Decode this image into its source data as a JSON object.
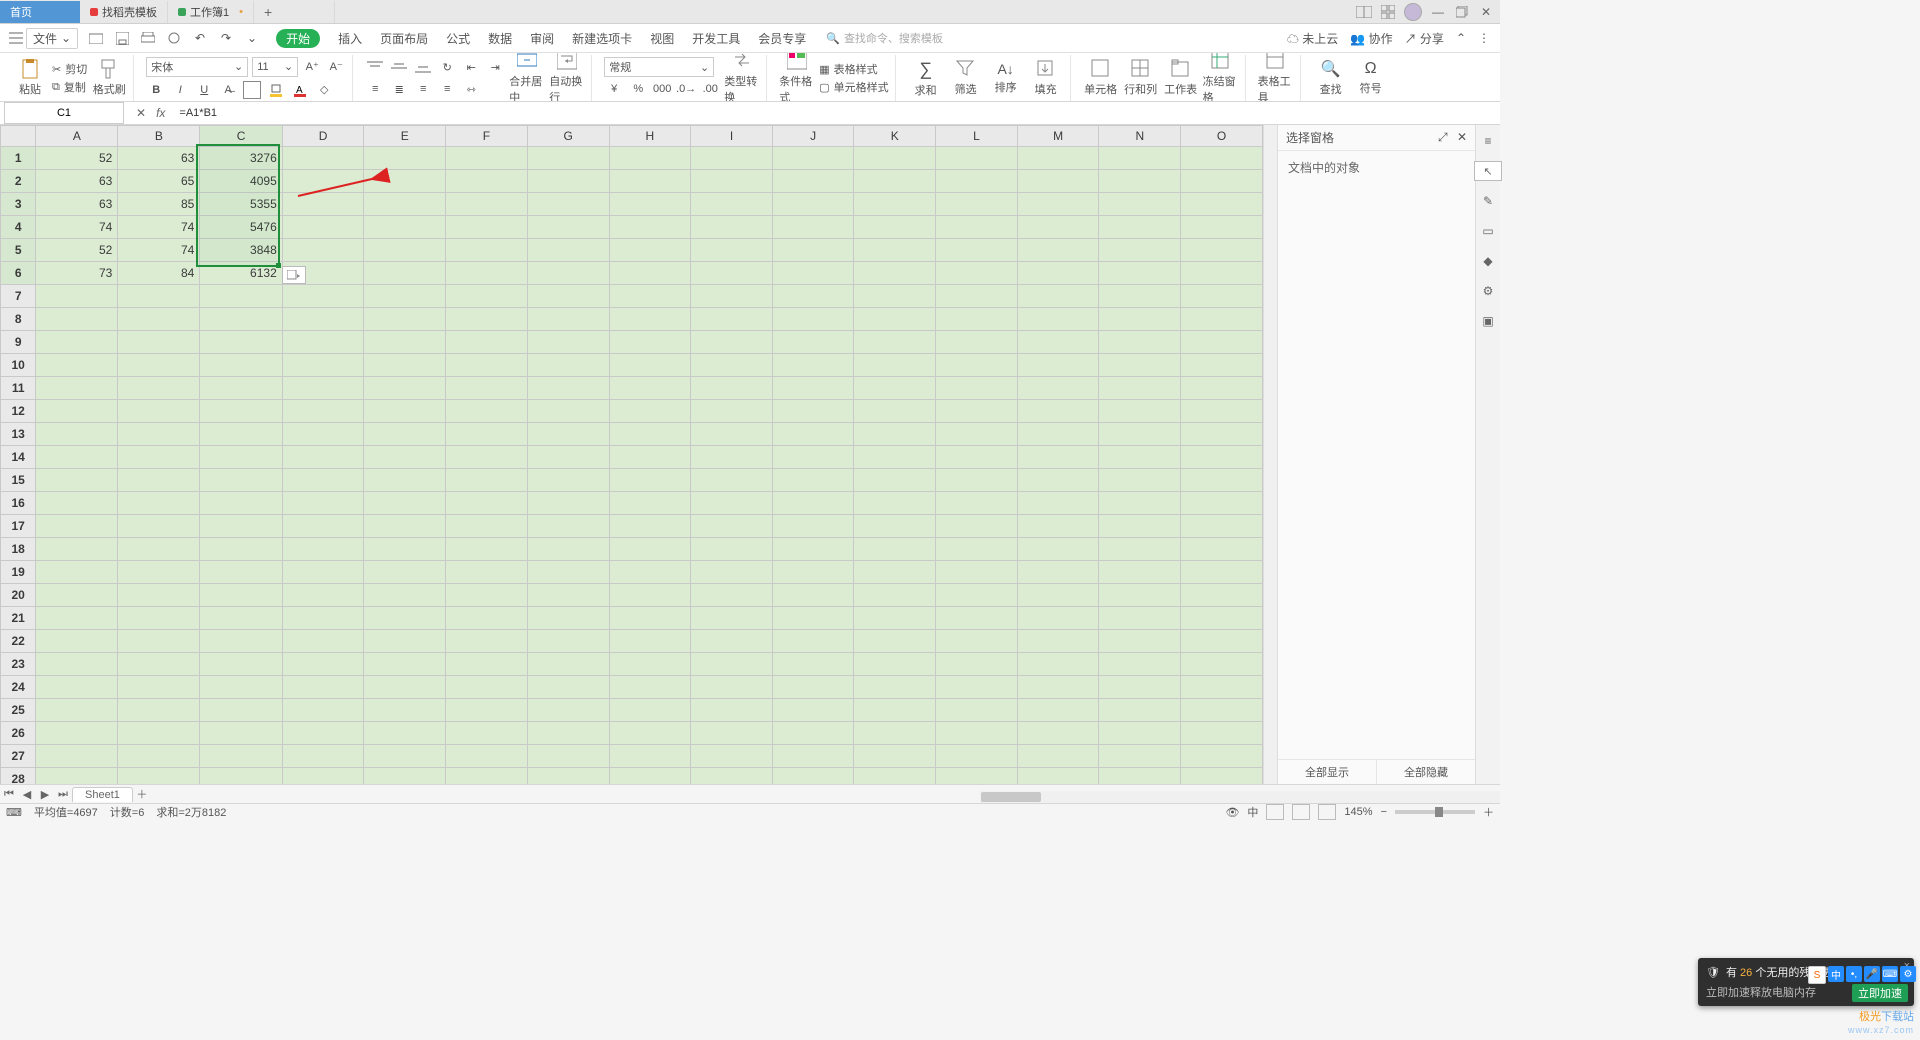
{
  "tabs": {
    "primary": "首页",
    "t1": "找稻壳模板",
    "t2": "工作簿1",
    "new": "+"
  },
  "file_menu": "文件",
  "menus": [
    "开始",
    "插入",
    "页面布局",
    "公式",
    "数据",
    "审阅",
    "新建选项卡",
    "视图",
    "开发工具",
    "会员专享"
  ],
  "search_placeholder": "查找命令、搜索模板",
  "cloud": "未上云",
  "coop": "协作",
  "share": "分享",
  "ribbon": {
    "paste": "粘贴",
    "cut": "剪切",
    "copy": "复制",
    "format_painter": "格式刷",
    "font_name": "宋体",
    "font_size": "11",
    "merge_center": "合并居中",
    "wrap": "自动换行",
    "number_fmt": "常规",
    "type_conv": "类型转换",
    "cond_fmt": "条件格式",
    "table_style": "表格样式",
    "cell_style": "单元格样式",
    "sum": "求和",
    "filter": "筛选",
    "sort": "排序",
    "fill": "填充",
    "cell": "单元格",
    "rowcol": "行和列",
    "sheet": "工作表",
    "freeze": "冻结窗格",
    "table_tool": "表格工具",
    "find": "查找",
    "symbol": "符号"
  },
  "namebox": "C1",
  "formula": "=A1*B1",
  "columns": [
    "A",
    "B",
    "C",
    "D",
    "E",
    "F",
    "G",
    "H",
    "I",
    "J",
    "K",
    "L",
    "M",
    "N",
    "O"
  ],
  "row_count": 30,
  "data": [
    {
      "A": "52",
      "B": "63",
      "C": "3276"
    },
    {
      "A": "63",
      "B": "65",
      "C": "4095"
    },
    {
      "A": "63",
      "B": "85",
      "C": "5355"
    },
    {
      "A": "74",
      "B": "74",
      "C": "5476"
    },
    {
      "A": "52",
      "B": "74",
      "C": "3848"
    },
    {
      "A": "73",
      "B": "84",
      "C": "6132"
    }
  ],
  "sheet_tab": "Sheet1",
  "sidepanel": {
    "title": "选择窗格",
    "sub": "文档中的对象",
    "show_all": "全部显示",
    "hide_all": "全部隐藏"
  },
  "status": {
    "avg": "平均值=4697",
    "count": "计数=6",
    "sum": "求和=2万8182",
    "zoom": "145%"
  },
  "toast": {
    "pre": "有",
    "num": "26",
    "post": "个无用的残留进程",
    "sub": "立即加速释放电脑内存",
    "go": "立即加速"
  },
  "watermark": {
    "a": "极光",
    "b": "下载站",
    "url": "www.xz7.com"
  }
}
